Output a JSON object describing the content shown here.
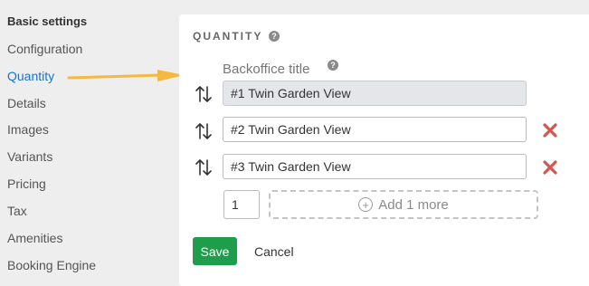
{
  "sidebar": {
    "heading": "Basic settings",
    "items": [
      {
        "label": "Configuration"
      },
      {
        "label": "Quantity"
      },
      {
        "label": "Details"
      },
      {
        "label": "Images"
      },
      {
        "label": "Variants"
      },
      {
        "label": "Pricing"
      },
      {
        "label": "Tax"
      },
      {
        "label": "Amenities"
      },
      {
        "label": "Booking Engine"
      }
    ],
    "active": "Quantity"
  },
  "annotation": {
    "arrow_color": "#f5b942",
    "icon": "arrow-right-icon"
  },
  "panel": {
    "section_title": "QUANTITY",
    "column_label": "Backoffice title",
    "rows": [
      {
        "value": "#1 Twin Garden View",
        "readonly": true
      },
      {
        "value": "#2 Twin Garden View",
        "removable": true
      },
      {
        "value": "#3 Twin Garden View",
        "removable": true
      }
    ],
    "add_count": "1",
    "add_more_label": "Add 1 more",
    "save_label": "Save",
    "cancel_label": "Cancel"
  },
  "colors": {
    "accent_link": "#1a73c7",
    "save": "#1e9e4a",
    "remove": "#d9534f"
  }
}
